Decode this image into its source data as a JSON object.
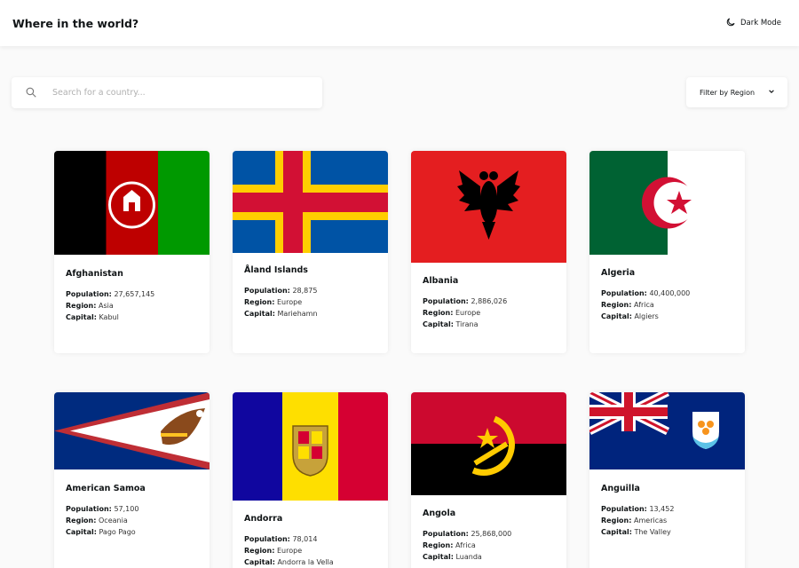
{
  "header": {
    "title": "Where in the world?",
    "dark_mode_label": "Dark Mode"
  },
  "search": {
    "placeholder": "Search for a country..."
  },
  "filter": {
    "label": "Filter by Region"
  },
  "labels": {
    "population": "Population:",
    "region": "Region:",
    "capital": "Capital:"
  },
  "countries": [
    {
      "name": "Afghanistan",
      "population": "27,657,145",
      "region": "Asia",
      "capital": "Kabul"
    },
    {
      "name": "Åland Islands",
      "population": "28,875",
      "region": "Europe",
      "capital": "Mariehamn"
    },
    {
      "name": "Albania",
      "population": "2,886,026",
      "region": "Europe",
      "capital": "Tirana"
    },
    {
      "name": "Algeria",
      "population": "40,400,000",
      "region": "Africa",
      "capital": "Algiers"
    },
    {
      "name": "American Samoa",
      "population": "57,100",
      "region": "Oceania",
      "capital": "Pago Pago"
    },
    {
      "name": "Andorra",
      "population": "78,014",
      "region": "Europe",
      "capital": "Andorra la Vella"
    },
    {
      "name": "Angola",
      "population": "25,868,000",
      "region": "Africa",
      "capital": "Luanda"
    },
    {
      "name": "Anguilla",
      "population": "13,452",
      "region": "Americas",
      "capital": "The Valley"
    }
  ],
  "colors": {
    "background": "#fafafa",
    "surface": "#ffffff",
    "text": "#111517"
  }
}
